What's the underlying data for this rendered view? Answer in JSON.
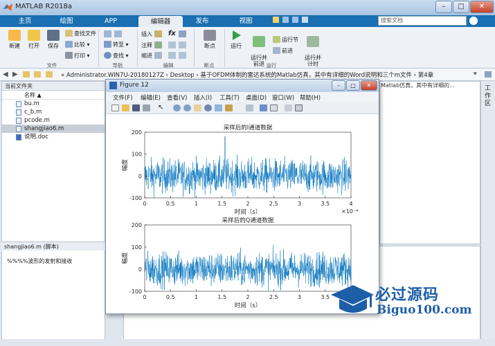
{
  "app": {
    "title": "MATLAB R2018a"
  },
  "window_controls": {
    "minimize": "–",
    "maximize": "□",
    "close": "✕"
  },
  "tabs": [
    {
      "label": "主页"
    },
    {
      "label": "绘图"
    },
    {
      "label": "APP"
    },
    {
      "label": "编辑器"
    },
    {
      "label": "发布"
    },
    {
      "label": "视图"
    }
  ],
  "search": {
    "placeholder": "搜索文档"
  },
  "ribbon": {
    "file": {
      "new": "新建",
      "open": "打开",
      "save": "保存",
      "find_files": "查找文件",
      "compare": "比较",
      "print": "打印",
      "group": "文件"
    },
    "navigate": {
      "goto": "转至",
      "find": "查找",
      "group": "导航"
    },
    "edit": {
      "insert": "插入",
      "comment": "注释",
      "indent": "缩进",
      "fx": "fx",
      "group": "编辑"
    },
    "breakpoints": {
      "label": "断点",
      "group": "断点"
    },
    "run": {
      "run": "运行",
      "run_advance": "运行并\n前进",
      "run_section": "运行节",
      "advance": "前进",
      "run_time": "运行并\n计时",
      "group": "运行"
    }
  },
  "address": {
    "path": "« Administrator.WIN7U-20180127Z › Desktop › 基于OFDM体制的雷达系统的Matlab仿真，其中有详细的Word说明和三个m文件 › 第4章"
  },
  "current_folder": {
    "title": "当前文件夹",
    "column": "名称 ▲",
    "files": [
      {
        "name": "bu.m"
      },
      {
        "name": "c_b.m"
      },
      {
        "name": "pcode.m"
      },
      {
        "name": "shangjiao6.m"
      },
      {
        "name": "说明.doc"
      }
    ],
    "selected_index": 3
  },
  "details": {
    "header": "shangjiao6.m (脚本)",
    "body": "%%%%波形的发射和接收"
  },
  "right_panel": {
    "label": "Matlab仿真，其中有详细的..."
  },
  "side_tab": {
    "label": "工作区"
  },
  "figure": {
    "title": "Figure 12",
    "menu": [
      "文件(F)",
      "编辑(E)",
      "查看(V)",
      "插入(I)",
      "工具(T)",
      "桌面(D)",
      "窗口(W)",
      "帮助(H)"
    ],
    "buttons": {
      "minimize": "–",
      "maximize": "□",
      "close": "✕"
    }
  },
  "chart_data": [
    {
      "type": "line",
      "title": "采样后的I通道数据",
      "xlabel": "时间（s）",
      "ylabel": "幅度",
      "x_exponent": "×10⁻⁴",
      "xlim": [
        0,
        4
      ],
      "ylim": [
        -100,
        200
      ],
      "xticks": [
        "0",
        "0.5",
        "1",
        "1.5",
        "2",
        "2.5",
        "3",
        "3.5",
        "4"
      ],
      "yticks": [
        "200",
        "100",
        "0",
        "-100"
      ],
      "color": "#0072bd",
      "series": [
        {
          "description": "noise-like signal, amplitude mostly within ±100, peak near 180"
        }
      ]
    },
    {
      "type": "line",
      "title": "采样后的Q通道数据",
      "xlabel": "时间（s）",
      "ylabel": "幅度",
      "xlim": [
        0,
        4
      ],
      "ylim": [
        -100,
        200
      ],
      "xticks": [
        "0",
        "0.5",
        "1",
        "1.5",
        "2",
        "2.5",
        "3",
        "3.5"
      ],
      "yticks": [
        "200",
        "100",
        "0",
        "-100"
      ],
      "color": "#0072bd",
      "series": [
        {
          "description": "noise-like signal, amplitude mostly within ±100"
        }
      ]
    }
  ],
  "watermark": {
    "text_cn": "必过源码",
    "url": "Biguo100.com"
  },
  "colors": {
    "tab_bar": "#1a6fb2",
    "plot_line": "#0072bd",
    "watermark": "#1c5ea8"
  }
}
